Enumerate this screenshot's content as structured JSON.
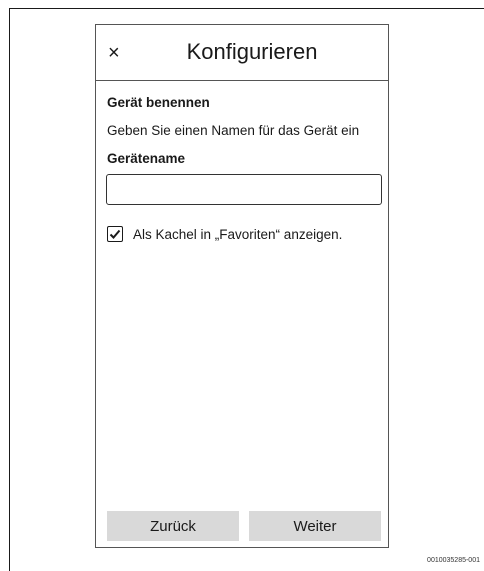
{
  "header": {
    "close_glyph": "×",
    "title": "Konfigurieren"
  },
  "form": {
    "section_title": "Gerät benennen",
    "description": "Geben Sie einen Namen für das Gerät ein",
    "field_label": "Gerätename",
    "name_value": "",
    "checkbox_checked": true,
    "checkbox_label": "Als Kachel in „Favoriten“ anzeigen."
  },
  "footer": {
    "back_label": "Zurück",
    "next_label": "Weiter"
  },
  "figure_id": "0010035285-001"
}
